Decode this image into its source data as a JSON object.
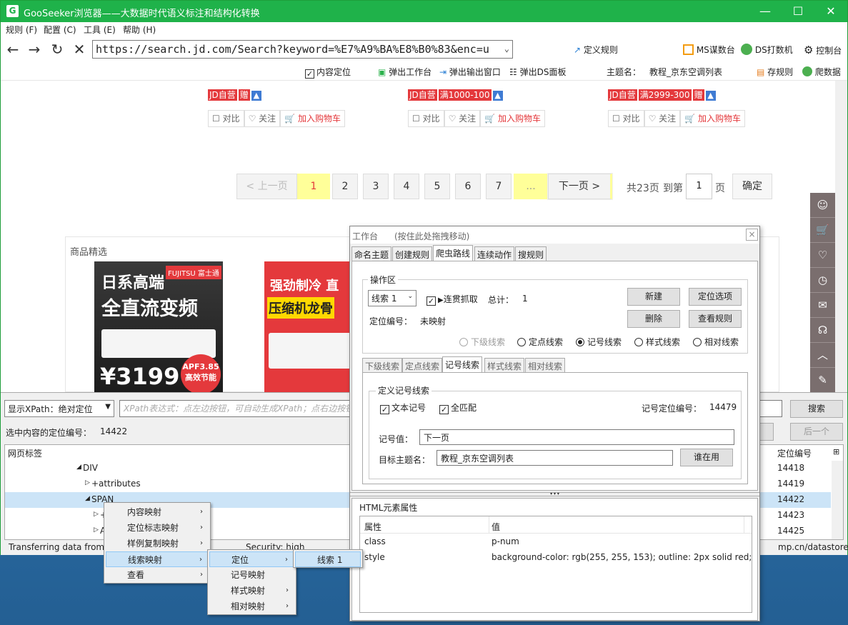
{
  "window": {
    "app_icon": "G",
    "title": "GooSeeker浏览器——大数据时代语义标注和结构化转换",
    "minimize": "—",
    "maximize": "☐",
    "close": "✕"
  },
  "menu": [
    "规则 (F)",
    "配置 (C)",
    "工具 (E)",
    "帮助 (H)"
  ],
  "nav": {
    "back": "←",
    "forward": "→",
    "refresh": "↻",
    "stop": "✕",
    "url": "https://search.jd.com/Search?keyword=%E7%A9%BA%E8%B0%83&enc=u",
    "url_dropdown": "⌄",
    "define_rule": "定义规则",
    "ms": "MS谋数台",
    "ds": "DS打数机",
    "console": "控制台"
  },
  "toolbar2": {
    "content_locate": "内容定位",
    "popup_workbench": "弹出工作台",
    "popup_output": "弹出输出窗口",
    "popup_ds": "弹出DS面板",
    "theme_label": "主题名：",
    "theme_value": "教程_京东空调列表",
    "save_rule": "存规则",
    "crawl": "爬数据"
  },
  "products": [
    {
      "tags": [
        "JD自营",
        "赠"
      ],
      "compare": "对比",
      "follow": "关注",
      "cart": "加入购物车"
    },
    {
      "tags": [
        "JD自营",
        "满1000-100"
      ],
      "compare": "对比",
      "follow": "关注",
      "cart": "加入购物车"
    },
    {
      "tags": [
        "JD自营",
        "满2999-300",
        "赠"
      ],
      "compare": "对比",
      "follow": "关注",
      "cart": "加入购物车"
    }
  ],
  "pagination": {
    "prev": "< 上一页",
    "pages": [
      "1",
      "2",
      "3",
      "4",
      "5",
      "6",
      "7",
      "..."
    ],
    "next": "下一页 >",
    "total": "共23页",
    "goto": "到第",
    "goto_value": "1",
    "page_unit": "页",
    "confirm": "确定"
  },
  "featured": {
    "title": "商品精选",
    "ad1_brand": "FUJITSU 富士通",
    "ad1_line1": "日系高端",
    "ad1_line2": "全直流变频",
    "ad1_badge1": "APF3.85",
    "ad1_badge2": "高效节能",
    "ad1_price": "¥3199",
    "ad2_line1": "强劲制冷 直",
    "ad2_line2": "压缩机龙骨"
  },
  "jd_sidebar": [
    "user-icon",
    "cart-icon",
    "heart-icon",
    "history-icon",
    "chat-icon",
    "support-icon",
    "top-icon",
    "edit-icon"
  ],
  "bottom": {
    "xpath_mode": "显示XPath：绝对定位",
    "xpath_placeholder": "XPath表达式：点左边按钮，可自动生成XPath；点右边按钮",
    "search": "搜索",
    "selected_label": "选中内容的定位编号：",
    "selected_value": "14422",
    "prev_btn": "",
    "next_btn": "后一个",
    "col_tag": "网页标签",
    "col_id": "定位编号",
    "tree_rows": [
      {
        "label": "DIV",
        "expander": "◢",
        "id": "14418"
      },
      {
        "label": "+attributes",
        "expander": "▷",
        "id": "14419"
      },
      {
        "label": "SPAN",
        "expander": "◢",
        "id": "14422"
      },
      {
        "label": "+",
        "expander": "▷",
        "id": "14423"
      },
      {
        "label": "A",
        "expander": "▷",
        "id": "14425"
      }
    ],
    "status_left": "Transferring data from",
    "status_mid": "Security: high",
    "status_right": "mp.cn/datastore/"
  },
  "workbench": {
    "title": "工作台",
    "hint": "(按住此处拖拽移动)",
    "close": "×",
    "tabs": [
      "命名主题",
      "创建规则",
      "爬虫路线",
      "连续动作",
      "搜规则"
    ],
    "section": "操作区",
    "clue_select": "线索 1",
    "continuous": "连贯抓取",
    "total_label": "总计：",
    "total_value": "1",
    "new": "新建",
    "locate_options": "定位选项",
    "delete": "删除",
    "view_rule": "查看规则",
    "loc_id_label": "定位编号：",
    "loc_id_value": "未映射",
    "radios": [
      "下级线索",
      "定点线索",
      "记号线索",
      "样式线索",
      "相对线索"
    ],
    "subtabs": [
      "下级线索",
      "定点线索",
      "记号线索",
      "样式线索",
      "相对线索"
    ],
    "define_title": "定义记号线索",
    "text_mark": "文本记号",
    "full_match": "全匹配",
    "mark_loc_label": "记号定位编号：",
    "mark_loc_value": "14479",
    "mark_value_label": "记号值：",
    "mark_value": "下一页",
    "target_label": "目标主题名：",
    "target_value": "教程_京东空调列表",
    "whose": "谁在用",
    "html_attrs": "HTML元素属性",
    "col_attr": "属性",
    "col_val": "值",
    "attrs": [
      {
        "k": "class",
        "v": "p-num"
      },
      {
        "k": "style",
        "v": "background-color: rgb(255, 255, 153); outline: 2px solid red;"
      }
    ]
  },
  "context_menu": {
    "main": [
      "内容映射",
      "定位标志映射",
      "样例复制映射",
      "线索映射",
      "查看"
    ],
    "sub": [
      "定位",
      "记号映射",
      "样式映射",
      "相对映射"
    ],
    "sub2": [
      "线索 1"
    ]
  },
  "colors": {
    "title_green": "#1fb24a",
    "jd_red": "#e4393c",
    "page_yellow": "#ffff99"
  }
}
